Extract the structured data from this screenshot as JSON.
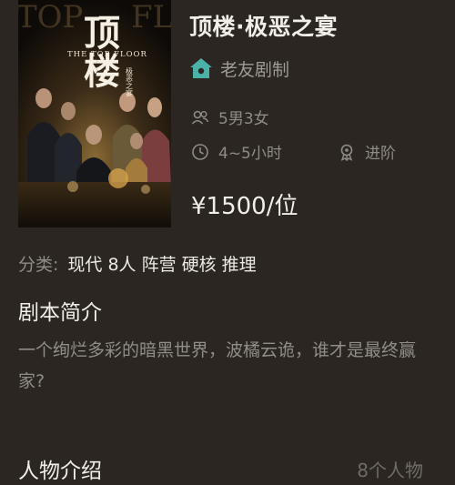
{
  "poster": {
    "title_cn": "顶楼",
    "title_en": "THE TOP FLOOR",
    "subtitle_cn": "极恶之宴",
    "bg_letters_left": "TOP",
    "bg_letters_right": "FLO"
  },
  "script": {
    "title": "顶楼·极恶之宴",
    "producer": "老友剧制",
    "cast": "5男3女",
    "duration": "4~5小时",
    "level": "进阶",
    "price": "¥1500/位"
  },
  "tags": {
    "label": "分类:",
    "value": "现代 8人 阵营 硬核 推理"
  },
  "intro": {
    "title": "剧本简介",
    "text": "一个绚烂多彩的暗黑世界，波橘云诡，谁才是最终赢家?"
  },
  "characters": {
    "title": "人物介绍",
    "count": "8个人物"
  },
  "colors": {
    "background": "#2b2622",
    "accent_teal": "#4bb2a8",
    "muted_text": "#8f8b86"
  },
  "icons": {
    "producer": "house-icon",
    "cast": "people-icon",
    "duration": "clock-icon",
    "level": "medal-icon"
  }
}
